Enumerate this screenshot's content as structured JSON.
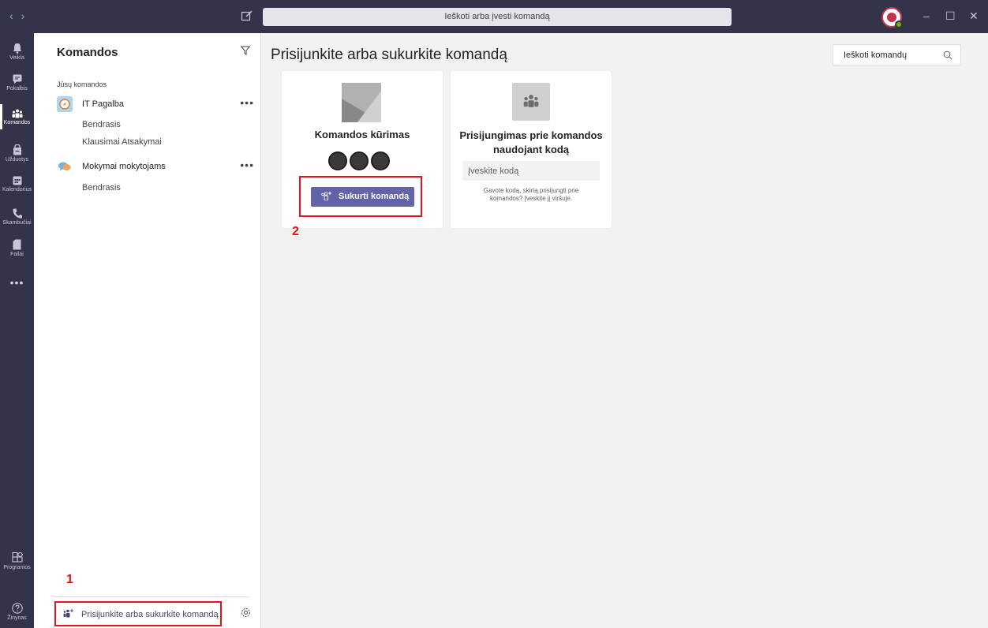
{
  "titlebar": {
    "search_text": "Ieškoti arba įvesti komandą",
    "nav_back_icon": "chevron-left-icon",
    "nav_forward_icon": "chevron-right-icon",
    "compose_icon": "compose-icon",
    "minimize": "–",
    "maximize": "☐",
    "close": "✕"
  },
  "rail": {
    "items": [
      {
        "label": "Veikla",
        "icon": "bell-icon"
      },
      {
        "label": "Pokalbis",
        "icon": "chat-icon"
      },
      {
        "label": "Komandos",
        "icon": "teams-icon",
        "active": true
      },
      {
        "label": "Užduotys",
        "icon": "assignments-icon"
      },
      {
        "label": "Kalendorius",
        "icon": "calendar-icon"
      },
      {
        "label": "Skambučiai",
        "icon": "phone-icon"
      },
      {
        "label": "Failai",
        "icon": "file-icon"
      }
    ],
    "more": "•••",
    "bottom": [
      {
        "label": "Programos",
        "icon": "apps-icon"
      },
      {
        "label": "Žinynas",
        "icon": "help-icon"
      }
    ]
  },
  "panel": {
    "title": "Komandos",
    "section_label": "Jūsų komandos",
    "teams": [
      {
        "name": "IT Pagalba",
        "more": "•••",
        "channels": [
          "Bendrasis",
          "Klausimai Atsakymai"
        ]
      },
      {
        "name": "Mokymai mokytojams",
        "more": "•••",
        "channels": [
          "Bendrasis"
        ]
      }
    ],
    "join_or_create": "Prisijunkite arba sukurkite komandą"
  },
  "annotations": {
    "one": "1",
    "two": "2"
  },
  "main": {
    "title": "Prisijunkite arba sukurkite komandą",
    "search_placeholder": "Ieškoti komandų",
    "create_card": {
      "title": "Komandos kūrimas",
      "button": "Sukurti komandą"
    },
    "join_card": {
      "title_line1": "Prisijungimas prie komandos",
      "title_line2": "naudojant kodą",
      "input_placeholder": "Įveskite kodą",
      "help_line1": "Gavote kodą, skirtą prisijungti prie",
      "help_line2": "komandos? Įveskite jį viršuje."
    }
  },
  "colors": {
    "rail_bg": "#33344a",
    "accent": "#6264a7",
    "annotation_red": "#e8111d"
  }
}
